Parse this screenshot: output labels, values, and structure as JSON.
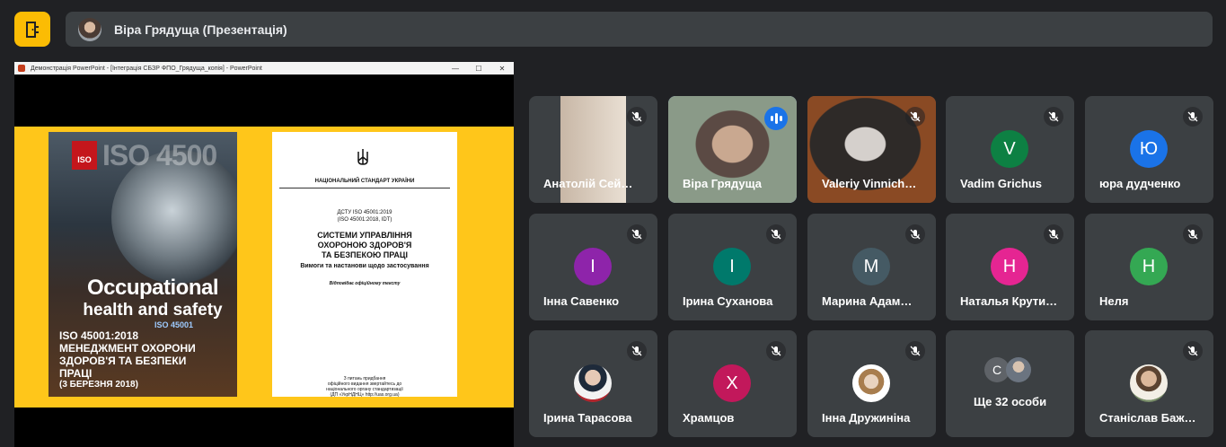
{
  "header": {
    "title": "Віра Грядуща (Презентація)"
  },
  "presentation": {
    "window_title": "Демонстрація PowerPoint - [Інтеграція СБЗР ФПО_Грядуща_копія] - PowerPoint",
    "window_controls": [
      "—",
      "☐",
      "✕"
    ],
    "cover": {
      "logo_text": "ISO",
      "watermark": "ISO 4500",
      "headline_1": "Occupational",
      "headline_2": "health and safety",
      "iso_tag": "ISO 45001",
      "standard_lines": [
        "ISO 45001:2018",
        "МЕНЕДЖМЕНТ ОХОРОНИ",
        "ЗДОРОВ'Я ТА БЕЗПЕКИ",
        "ПРАЦІ"
      ],
      "date": "(3 БЕРЕЗНЯ 2018)"
    },
    "document": {
      "national": "НАЦІОНАЛЬНИЙ СТАНДАРТ УКРАЇНИ",
      "dstu_1": "ДСТУ ISO 45001:2019",
      "dstu_2": "(ISO 45001:2018, IDT)",
      "system_title_1": "СИСТЕМИ УПРАВЛІННЯ",
      "system_title_2": "ОХОРОНОЮ ЗДОРОВ'Я",
      "system_title_3": "ТА БЕЗПЕКОЮ ПРАЦІ",
      "requirements": "Вимоги та настанови щодо застосування",
      "original": "Відповідає офіційному тексту",
      "footer_1": "З питань придбання",
      "footer_2": "офіційного видання звертайтесь до",
      "footer_3": "національного органу стандартизації",
      "footer_4": "(ДП «УкрНДНЦ» http://uas.org.ua)"
    }
  },
  "participants": [
    {
      "name": "Анатолій Сей…",
      "type": "video"
    },
    {
      "name": "Віра Грядуща",
      "type": "video",
      "speaking": true
    },
    {
      "name": "Valeriy Vinnich…",
      "type": "video"
    },
    {
      "name": "Vadim Grichus",
      "initial": "V",
      "color": "#0d8043"
    },
    {
      "name": "юра дудченко",
      "initial": "Ю",
      "color": "#1a73e8"
    },
    {
      "name": "Інна Савенко",
      "initial": "І",
      "color": "#8e24aa"
    },
    {
      "name": "Ірина Суханова",
      "initial": "І",
      "color": "#00796b"
    },
    {
      "name": "Марина Адам…",
      "initial": "М",
      "color": "#455a64"
    },
    {
      "name": "Наталья Крути…",
      "initial": "Н",
      "color": "#e52592"
    },
    {
      "name": "Неля",
      "initial": "Н",
      "color": "#34a853"
    },
    {
      "name": "Ірина Тарасова",
      "type": "photo"
    },
    {
      "name": "Храмцов",
      "initial": "Х",
      "color": "#c2185b"
    },
    {
      "name": "Інна Дружиніна",
      "type": "photo"
    },
    {
      "name": "Станіслав Баж…",
      "type": "photo"
    }
  ],
  "more": {
    "label": "Ще 32 особи",
    "initial": "С"
  },
  "colors": {
    "background": "#202124",
    "tile": "#3c4043",
    "accent": "#fbbc04",
    "active_outline": "#8ab4f8"
  }
}
